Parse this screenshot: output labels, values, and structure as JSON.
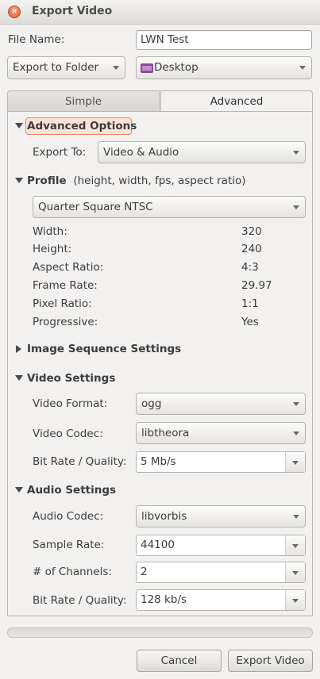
{
  "window": {
    "title": "Export Video"
  },
  "file": {
    "label": "File Name:",
    "value": "LWN Test"
  },
  "destination": {
    "mode": "Export to Folder",
    "folder": "Desktop"
  },
  "tabs": {
    "simple": "Simple",
    "advanced": "Advanced"
  },
  "advanced_options": {
    "title": "Advanced Options",
    "export_to_label": "Export To:",
    "export_to_value": "Video & Audio"
  },
  "profile": {
    "title": "Profile",
    "hint": "(height, width, fps, aspect ratio)",
    "selected": "Quarter Square NTSC",
    "rows": [
      {
        "label": "Width:",
        "value": "320"
      },
      {
        "label": "Height:",
        "value": "240"
      },
      {
        "label": "Aspect Ratio:",
        "value": "4:3"
      },
      {
        "label": "Frame Rate:",
        "value": "29.97"
      },
      {
        "label": "Pixel Ratio:",
        "value": "1:1"
      },
      {
        "label": "Progressive:",
        "value": "Yes"
      }
    ]
  },
  "image_sequence": {
    "title": "Image Sequence Settings"
  },
  "video": {
    "title": "Video Settings",
    "format_label": "Video Format:",
    "format_value": "ogg",
    "codec_label": "Video Codec:",
    "codec_value": "libtheora",
    "bitrate_label": "Bit Rate / Quality:",
    "bitrate_value": "5 Mb/s"
  },
  "audio": {
    "title": "Audio Settings",
    "codec_label": "Audio Codec:",
    "codec_value": "libvorbis",
    "sample_label": "Sample Rate:",
    "sample_value": "44100",
    "channels_label": "# of Channels:",
    "channels_value": "2",
    "bitrate_label": "Bit Rate / Quality:",
    "bitrate_value": "128 kb/s"
  },
  "buttons": {
    "cancel": "Cancel",
    "export": "Export Video"
  }
}
